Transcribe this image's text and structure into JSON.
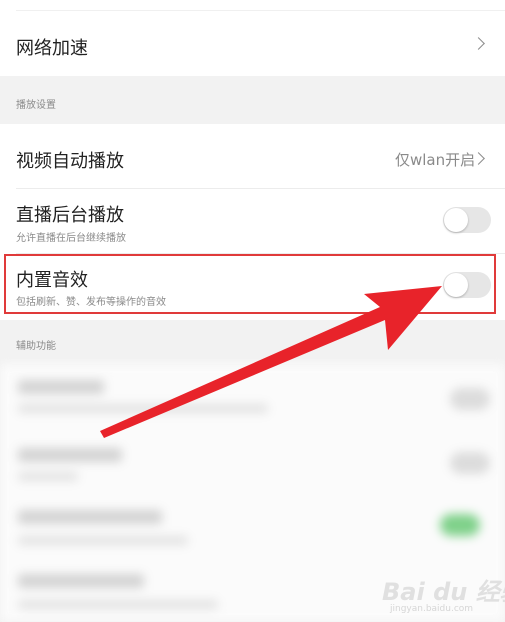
{
  "settings": {
    "network_boost": {
      "title": "网络加速"
    },
    "playback_section": "播放设置",
    "autoplay": {
      "title": "视频自动播放",
      "value": "仅wlan开启"
    },
    "live_background": {
      "title": "直播后台播放",
      "subtitle": "允许直播在后台继续播放",
      "enabled": false
    },
    "builtin_sound": {
      "title": "内置音效",
      "subtitle": "包括刷新、赞、发布等操作的音效",
      "enabled": false
    },
    "accessibility_section": "辅助功能"
  },
  "watermark": {
    "brand": "Bai du 经验",
    "url": "jingyan.baidu.com"
  },
  "colors": {
    "highlight_box": "#e03a3a",
    "arrow": "#e8232a",
    "toggle_off": "#e6e6e6"
  },
  "icons": {
    "chevron": "chevron-right-icon"
  }
}
